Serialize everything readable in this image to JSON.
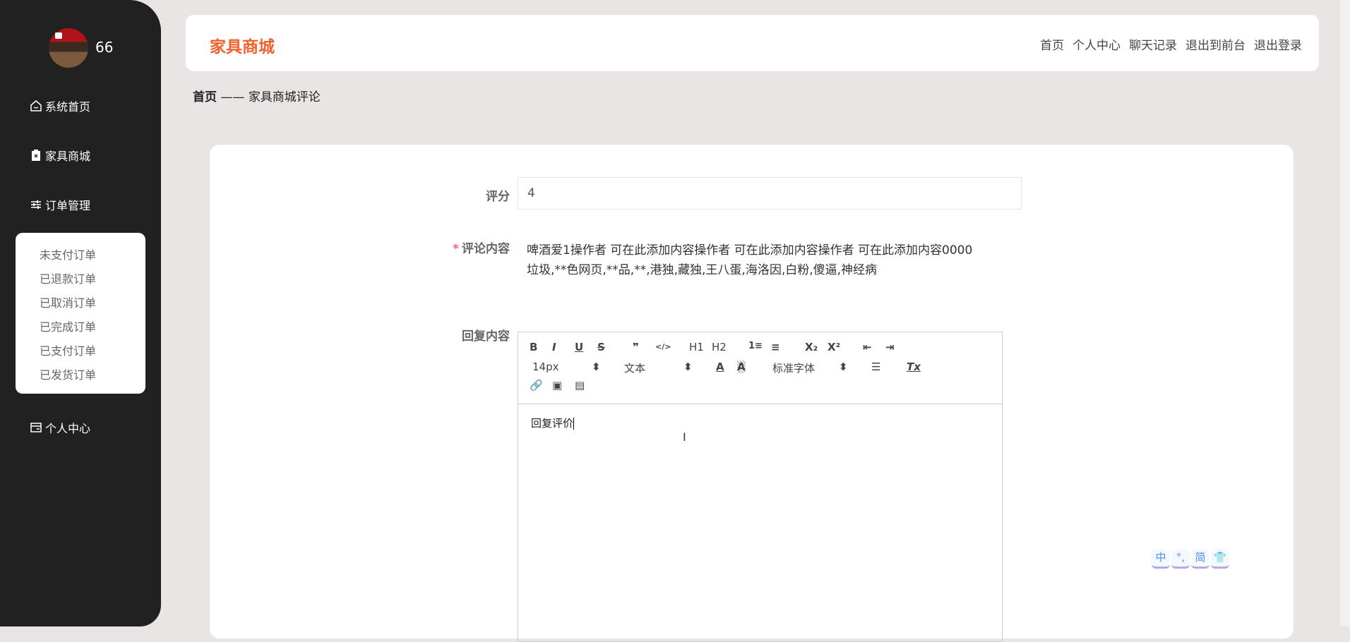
{
  "user": {
    "name": "66"
  },
  "sidebar": {
    "items": [
      {
        "label": "系统首页",
        "icon": "home-icon"
      },
      {
        "label": "家具商城",
        "icon": "clipboard-icon"
      },
      {
        "label": "订单管理",
        "icon": "sliders-icon"
      },
      {
        "label": "个人中心",
        "icon": "card-icon"
      }
    ],
    "order_sub": [
      "未支付订单",
      "已退款订单",
      "已取消订单",
      "已完成订单",
      "已支付订单",
      "已发货订单"
    ]
  },
  "header": {
    "title": "家具商城",
    "nav": [
      "首页",
      "个人中心",
      "聊天记录",
      "退出到前台",
      "退出登录"
    ]
  },
  "breadcrumb": {
    "home": "首页",
    "sep": "——",
    "current": "家具商城评论"
  },
  "form": {
    "score_label": "评分",
    "score_value": "4",
    "comment_label": "评论内容",
    "required_mark": "*",
    "comment_lines": [
      "啤酒爱1操作者 可在此添加内容操作者 可在此添加内容操作者 可在此添加内容0000",
      "垃圾,**色网页,**品,**,港独,藏独,王八蛋,海洛因,白粉,傻逼,神经病"
    ],
    "reply_label": "回复内容",
    "reply_value": "回复评价"
  },
  "editor": {
    "toolbar_row1": [
      "B",
      "I",
      "U",
      "S",
      "❞",
      "</>",
      "H1",
      "H2",
      "1≡",
      "≡",
      "X₂",
      "X²",
      "⇤",
      "⇥"
    ],
    "font_size": "14px",
    "header_select": "文本",
    "font_family": "标准字体",
    "clean": "Tx"
  },
  "widget": [
    "中",
    "°,",
    "简",
    "👕"
  ]
}
